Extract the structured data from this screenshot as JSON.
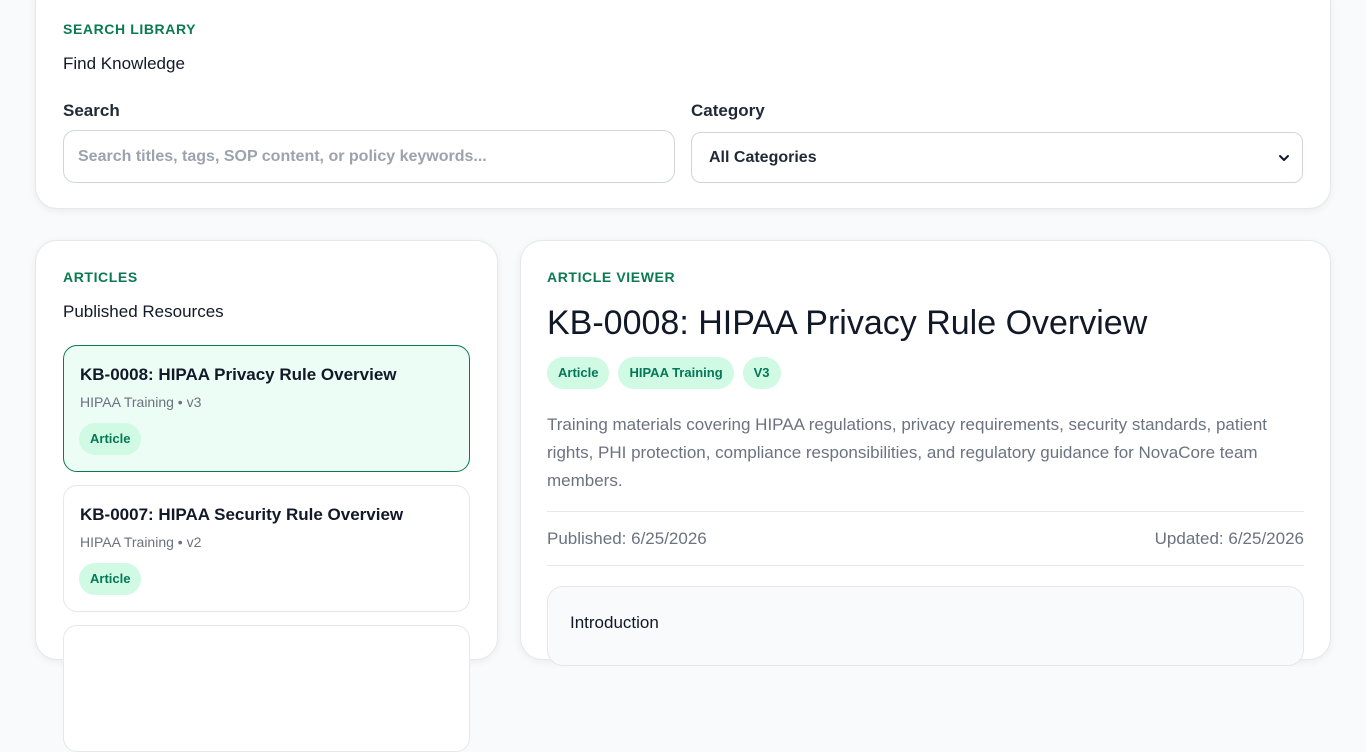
{
  "search_card": {
    "eyebrow": "SEARCH LIBRARY",
    "title": "Find Knowledge",
    "search_label": "Search",
    "search_placeholder": "Search titles, tags, SOP content, or policy keywords...",
    "search_value": "",
    "category_label": "Category",
    "category_value": "All Categories"
  },
  "articles_card": {
    "eyebrow": "ARTICLES",
    "title": "Published Resources",
    "items": [
      {
        "title": "KB-0008: HIPAA Privacy Rule Overview",
        "meta": "HIPAA Training • v3",
        "badge": "Article",
        "selected": true
      },
      {
        "title": "KB-0007: HIPAA Security Rule Overview",
        "meta": "HIPAA Training • v2",
        "badge": "Article",
        "selected": false
      }
    ]
  },
  "viewer": {
    "eyebrow": "ARTICLE VIEWER",
    "title": "KB-0008: HIPAA Privacy Rule Overview",
    "tags": [
      "Article",
      "HIPAA Training",
      "V3"
    ],
    "description": "Training materials covering HIPAA regulations, privacy requirements, security standards, patient rights, PHI protection, compliance responsibilities, and regulatory guidance for NovaCore team members.",
    "published": "Published: 6/25/2026",
    "updated": "Updated: 6/25/2026",
    "section_title": "Introduction"
  },
  "colors": {
    "accent": "#0b7a52",
    "pill_bg": "#d1fae5",
    "selected_bg": "#ecfdf5"
  },
  "icons": {
    "select_chevron": "chevron-down-icon"
  }
}
